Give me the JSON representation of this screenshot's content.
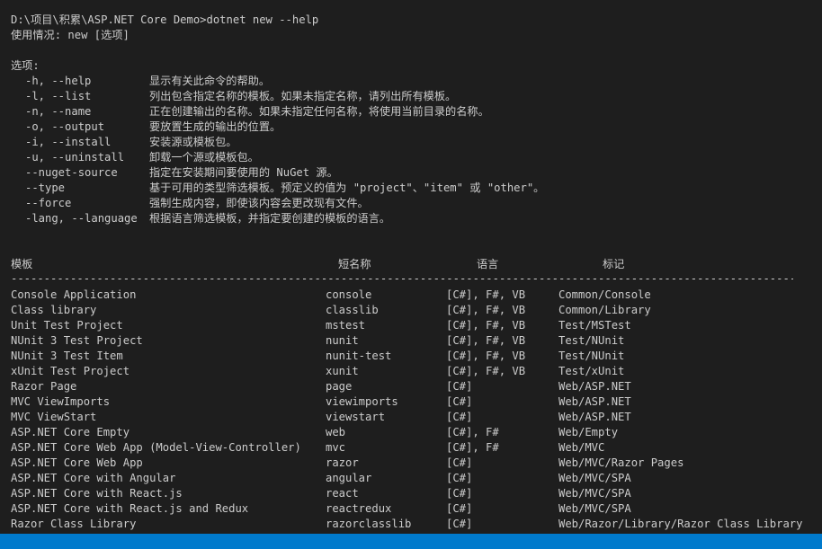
{
  "terminal": {
    "prompt_line": "D:\\项目\\积累\\ASP.NET Core Demo>dotnet new --help",
    "usage_line": "使用情况: new [选项]",
    "options_header": "选项:",
    "options": [
      {
        "flag": "-h, --help",
        "desc": "显示有关此命令的帮助。"
      },
      {
        "flag": "-l, --list",
        "desc": "列出包含指定名称的模板。如果未指定名称，请列出所有模板。"
      },
      {
        "flag": "-n, --name",
        "desc": "正在创建输出的名称。如果未指定任何名称，将使用当前目录的名称。"
      },
      {
        "flag": "-o, --output",
        "desc": "要放置生成的输出的位置。"
      },
      {
        "flag": "-i, --install",
        "desc": "安装源或模板包。"
      },
      {
        "flag": "-u, --uninstall",
        "desc": "卸载一个源或模板包。"
      },
      {
        "flag": "--nuget-source",
        "desc": "指定在安装期间要使用的 NuGet 源。"
      },
      {
        "flag": "--type",
        "desc": "基于可用的类型筛选模板。预定义的值为 \"project\"、\"item\" 或 \"other\"。"
      },
      {
        "flag": "--force",
        "desc": "强制生成内容，即使该内容会更改现有文件。"
      },
      {
        "flag": "-lang, --language",
        "desc": "根据语言筛选模板，并指定要创建的模板的语言。"
      }
    ],
    "table": {
      "headers": {
        "template": "模板",
        "short_name": "短名称",
        "language": "语言",
        "tags": "标记"
      },
      "separator": "--------------------------------------------------------------------------------------------------------------------------------------",
      "rows": [
        {
          "template": "Console Application",
          "short_name": "console",
          "language": "[C#], F#, VB",
          "tags": "Common/Console"
        },
        {
          "template": "Class library",
          "short_name": "classlib",
          "language": "[C#], F#, VB",
          "tags": "Common/Library"
        },
        {
          "template": "Unit Test Project",
          "short_name": "mstest",
          "language": "[C#], F#, VB",
          "tags": "Test/MSTest"
        },
        {
          "template": "NUnit 3 Test Project",
          "short_name": "nunit",
          "language": "[C#], F#, VB",
          "tags": "Test/NUnit"
        },
        {
          "template": "NUnit 3 Test Item",
          "short_name": "nunit-test",
          "language": "[C#], F#, VB",
          "tags": "Test/NUnit"
        },
        {
          "template": "xUnit Test Project",
          "short_name": "xunit",
          "language": "[C#], F#, VB",
          "tags": "Test/xUnit"
        },
        {
          "template": "Razor Page",
          "short_name": "page",
          "language": "[C#]",
          "tags": "Web/ASP.NET"
        },
        {
          "template": "MVC ViewImports",
          "short_name": "viewimports",
          "language": "[C#]",
          "tags": "Web/ASP.NET"
        },
        {
          "template": "MVC ViewStart",
          "short_name": "viewstart",
          "language": "[C#]",
          "tags": "Web/ASP.NET"
        },
        {
          "template": "ASP.NET Core Empty",
          "short_name": "web",
          "language": "[C#], F#",
          "tags": "Web/Empty"
        },
        {
          "template": "ASP.NET Core Web App (Model-View-Controller)",
          "short_name": "mvc",
          "language": "[C#], F#",
          "tags": "Web/MVC"
        },
        {
          "template": "ASP.NET Core Web App",
          "short_name": "razor",
          "language": "[C#]",
          "tags": "Web/MVC/Razor Pages"
        },
        {
          "template": "ASP.NET Core with Angular",
          "short_name": "angular",
          "language": "[C#]",
          "tags": "Web/MVC/SPA"
        },
        {
          "template": "ASP.NET Core with React.js",
          "short_name": "react",
          "language": "[C#]",
          "tags": "Web/MVC/SPA"
        },
        {
          "template": "ASP.NET Core with React.js and Redux",
          "short_name": "reactredux",
          "language": "[C#]",
          "tags": "Web/MVC/SPA"
        },
        {
          "template": "Razor Class Library",
          "short_name": "razorclasslib",
          "language": "[C#]",
          "tags": "Web/Razor/Library/Razor Class Library"
        }
      ]
    }
  },
  "colors": {
    "background": "#1e1e1e",
    "foreground": "#cccccc",
    "statusbar": "#007acc"
  }
}
